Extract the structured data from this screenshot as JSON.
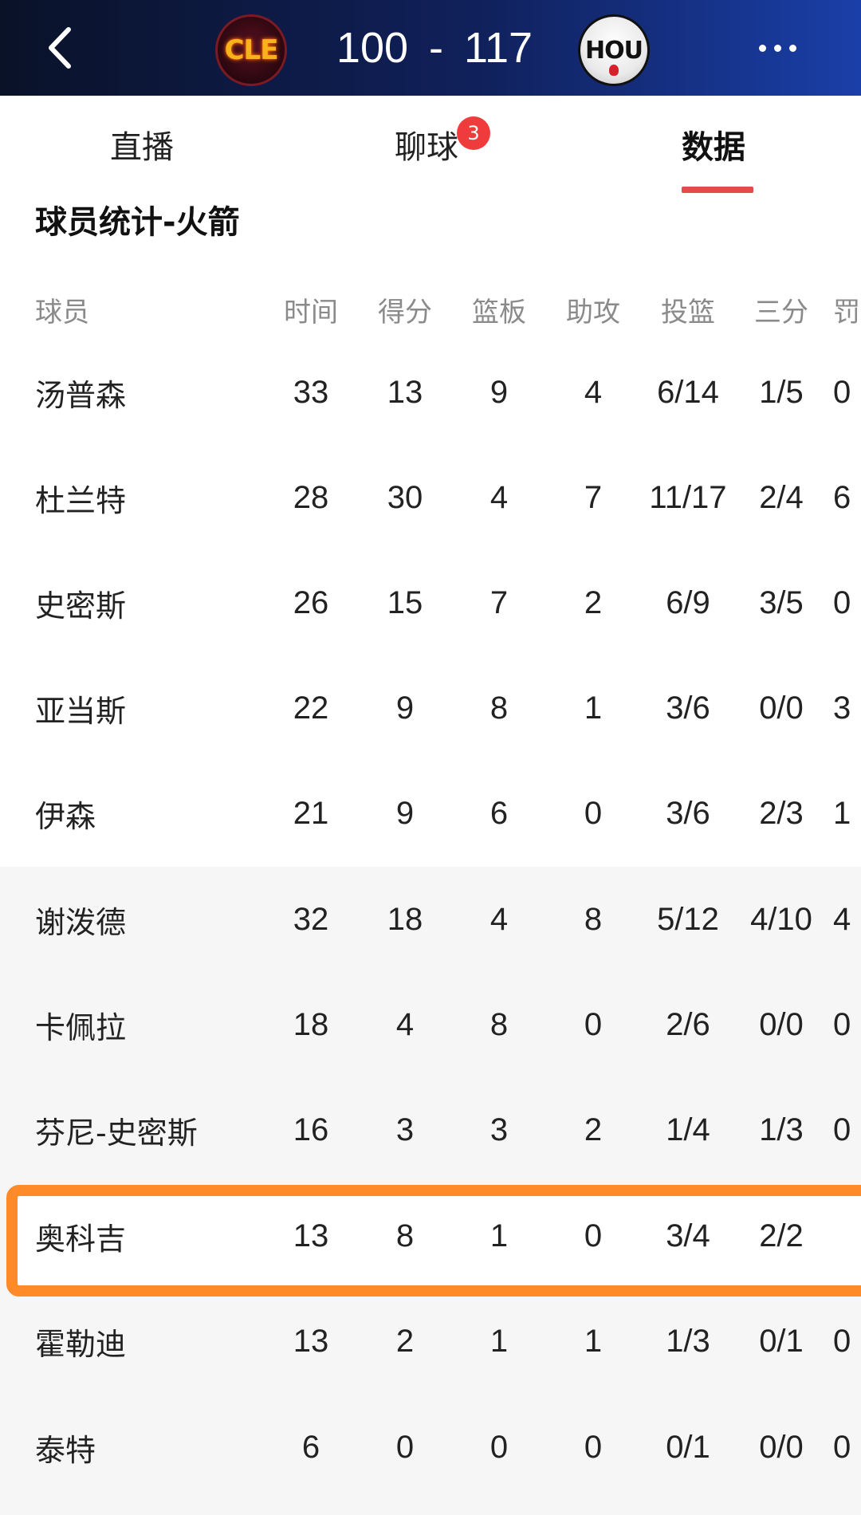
{
  "header": {
    "back_icon": "chevron-left-icon",
    "home_team_logo_text": "CLE",
    "home_score": "100",
    "separator": "-",
    "away_score": "117",
    "away_team_logo_text": "HOU",
    "more_icon": "more-horizontal-icon"
  },
  "tabs": [
    {
      "label": "直播",
      "active": false
    },
    {
      "label": "聊球",
      "active": false,
      "badge": "3"
    },
    {
      "label": "数据",
      "active": true
    }
  ],
  "colors": {
    "header_start": "#0a1228",
    "header_end": "#1a3fa8",
    "tab_indicator": "#e24b4b",
    "badge": "#ef3b3b",
    "highlight": "#ff8a2a"
  },
  "section": {
    "title": "球员统计-火箭"
  },
  "table": {
    "headers": [
      "球员",
      "时间",
      "得分",
      "篮板",
      "助攻",
      "投篮",
      "三分",
      "罚"
    ],
    "rows": [
      [
        "汤普森",
        "33",
        "13",
        "9",
        "4",
        "6/14",
        "1/5",
        "0"
      ],
      [
        "杜兰特",
        "28",
        "30",
        "4",
        "7",
        "11/17",
        "2/4",
        "6"
      ],
      [
        "史密斯",
        "26",
        "15",
        "7",
        "2",
        "6/9",
        "3/5",
        "0"
      ],
      [
        "亚当斯",
        "22",
        "9",
        "8",
        "1",
        "3/6",
        "0/0",
        "3"
      ],
      [
        "伊森",
        "21",
        "9",
        "6",
        "0",
        "3/6",
        "2/3",
        "1"
      ],
      [
        "谢泼德",
        "32",
        "18",
        "4",
        "8",
        "5/12",
        "4/10",
        "4"
      ],
      [
        "卡佩拉",
        "18",
        "4",
        "8",
        "0",
        "2/6",
        "0/0",
        "0"
      ],
      [
        "芬尼-史密斯",
        "16",
        "3",
        "3",
        "2",
        "1/4",
        "1/3",
        "0"
      ],
      [
        "奥科吉",
        "13",
        "8",
        "1",
        "0",
        "3/4",
        "2/2",
        ""
      ],
      [
        "霍勒迪",
        "13",
        "2",
        "1",
        "1",
        "1/3",
        "0/1",
        "0"
      ],
      [
        "泰特",
        "6",
        "0",
        "0",
        "0",
        "0/1",
        "0/0",
        "0"
      ]
    ],
    "starter_count": 5,
    "highlighted_player": "奥科吉"
  }
}
